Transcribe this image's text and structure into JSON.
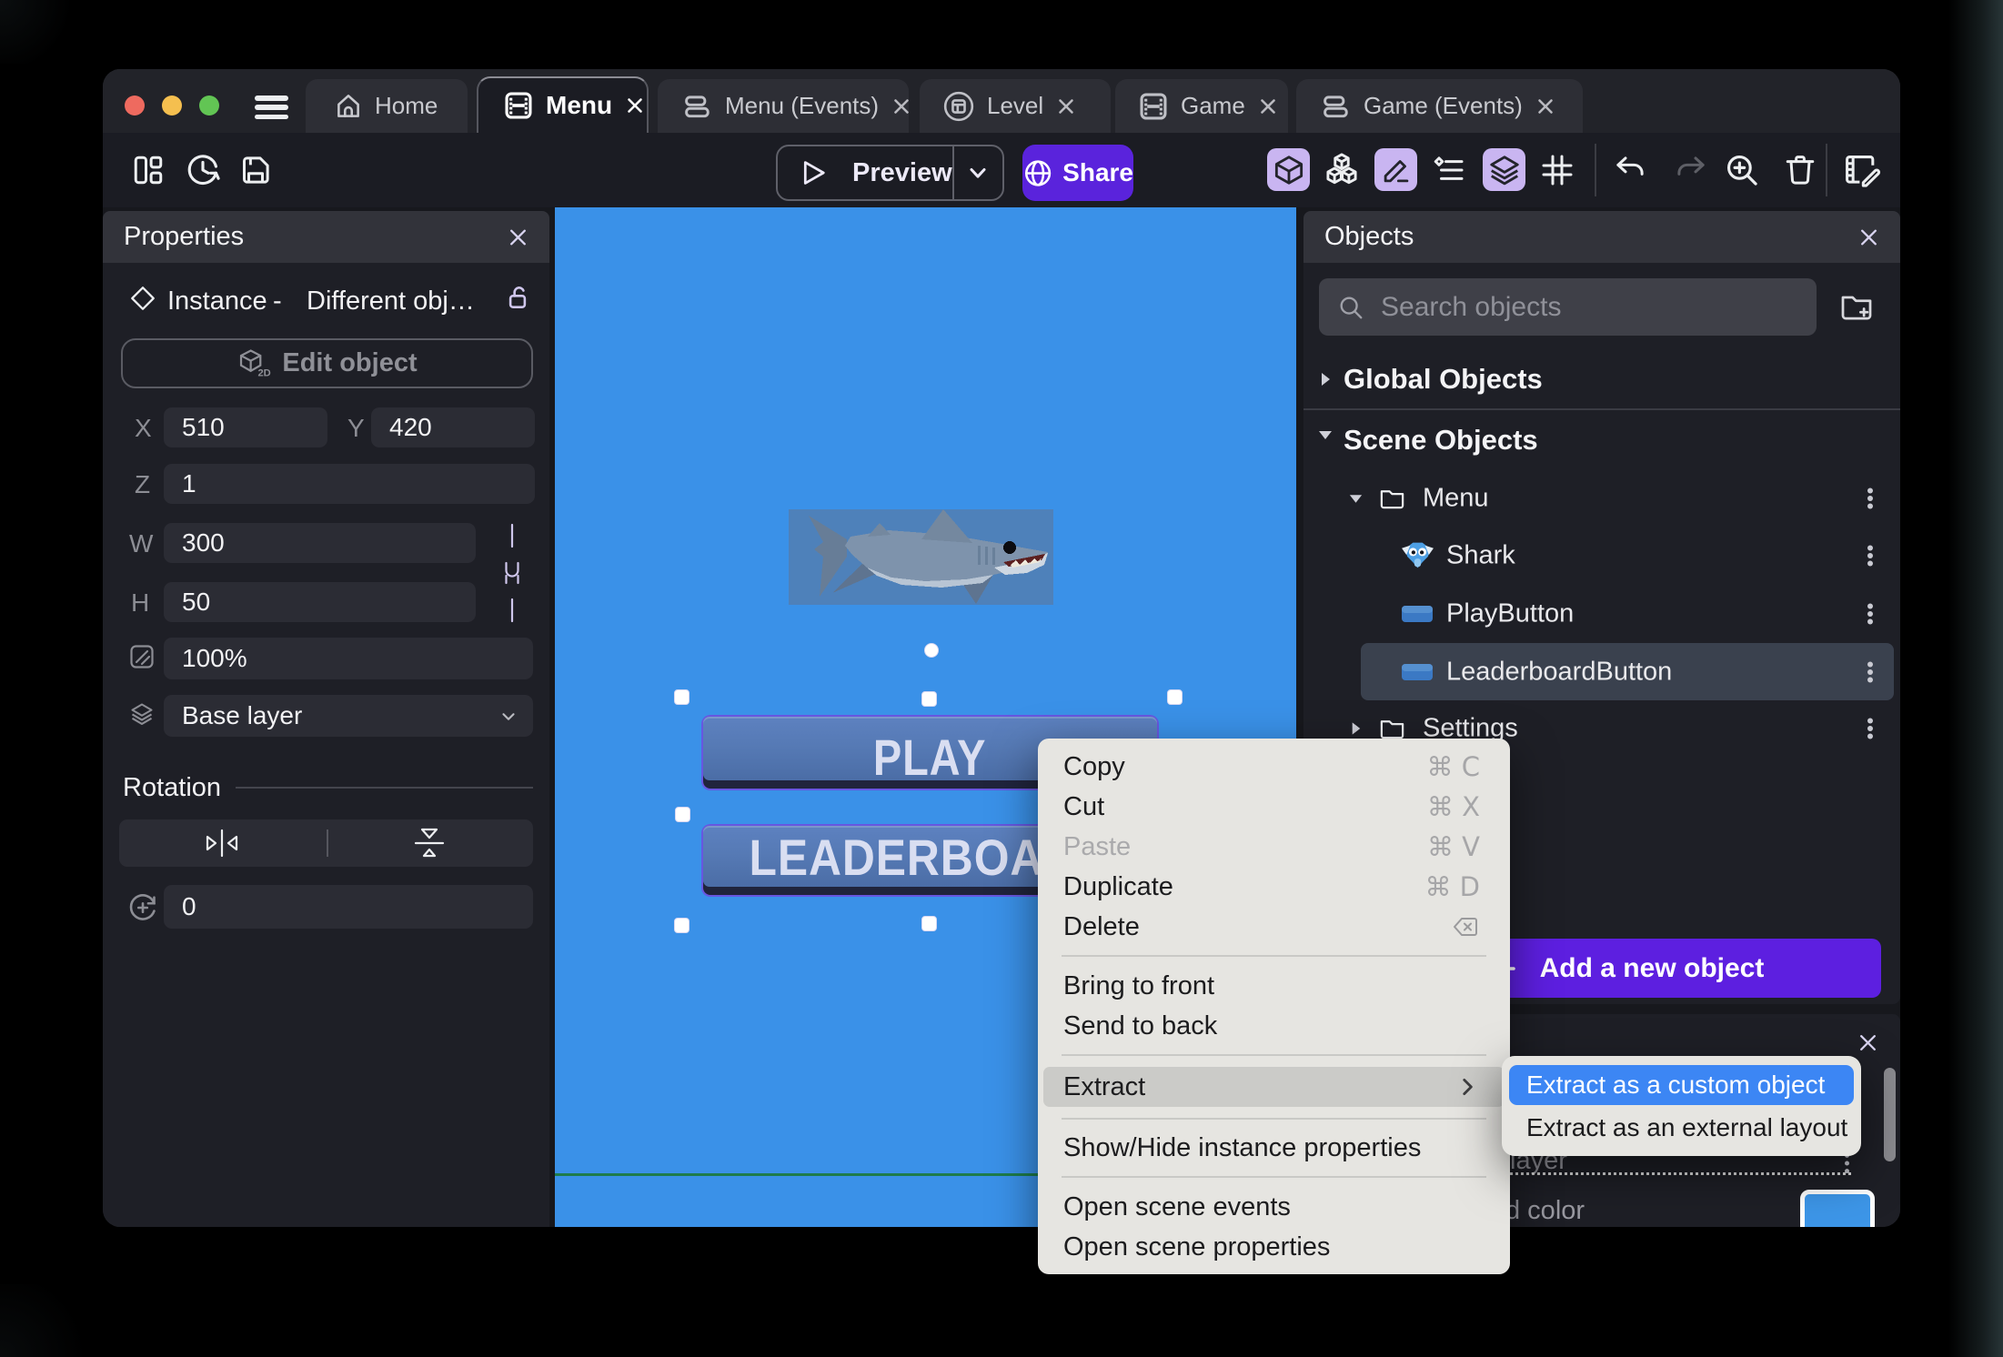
{
  "window": {
    "traffic_lights": {
      "close": "#ee6a5f",
      "minimize": "#f5bf4f",
      "zoom": "#62c554"
    }
  },
  "tabs": [
    {
      "label": "Home",
      "icon": "home-icon",
      "closable": false,
      "active": false
    },
    {
      "label": "Menu",
      "icon": "scene-icon",
      "closable": true,
      "active": true
    },
    {
      "label": "Menu (Events)",
      "icon": "events-icon",
      "closable": true,
      "active": false
    },
    {
      "label": "Level",
      "icon": "external-layout-icon",
      "closable": true,
      "active": false
    },
    {
      "label": "Game",
      "icon": "scene-icon",
      "closable": true,
      "active": false
    },
    {
      "label": "Game (Events)",
      "icon": "events-icon",
      "closable": true,
      "active": false
    }
  ],
  "toolbar": {
    "preview_label": "Preview",
    "share_label": "Share",
    "accent_purple": "#5a23dc",
    "icon_highlight": "#c9b5f1",
    "icons_left": [
      "panels-icon",
      "history-icon",
      "save-icon"
    ],
    "icons_right": [
      "cube-3d-icon",
      "instances-icon",
      "pencil-icon",
      "instance-list-icon",
      "layers-icon",
      "grid-icon",
      "undo-icon",
      "redo-icon",
      "zoom-in-icon",
      "trash-icon",
      "scene-edit-icon"
    ]
  },
  "properties_panel": {
    "title": "Properties",
    "instance_type": "Instance",
    "instance_sep": "-",
    "instance_name": "Different obj…",
    "edit_object_label": "Edit object",
    "labels": {
      "x": "X",
      "y": "Y",
      "z": "Z",
      "w": "W",
      "h": "H"
    },
    "values": {
      "x": "510",
      "y": "420",
      "z": "1",
      "w": "300",
      "h": "50",
      "opacity": "100%",
      "layer": "Base layer",
      "rotation": "0"
    },
    "rotation_title": "Rotation"
  },
  "canvas": {
    "background": "#3a91e8",
    "play_label": "PLAY",
    "leaderboard_label": "LEADERBOARD",
    "scene_border_color": "#1e7c4c"
  },
  "objects_panel": {
    "title": "Objects",
    "search_placeholder": "Search objects",
    "global_section": "Global Objects",
    "scene_section": "Scene Objects",
    "tree": [
      {
        "label": "Menu",
        "type": "folder",
        "expanded": true
      },
      {
        "label": "Shark",
        "type": "sprite"
      },
      {
        "label": "PlayButton",
        "type": "button"
      },
      {
        "label": "LeaderboardButton",
        "type": "button",
        "selected": true
      },
      {
        "label": "Settings",
        "type": "folder",
        "expanded": false
      }
    ],
    "add_button_label": "Add a new object"
  },
  "bottom_panel": {
    "layer_text": "layer",
    "color_text": "d color",
    "swatch_color": "#3d96e8"
  },
  "context_menu": {
    "items": [
      {
        "label": "Copy",
        "shortcut": "⌘ C"
      },
      {
        "label": "Cut",
        "shortcut": "⌘ X"
      },
      {
        "label": "Paste",
        "shortcut": "⌘ V",
        "disabled": true
      },
      {
        "label": "Duplicate",
        "shortcut": "⌘ D"
      },
      {
        "label": "Delete",
        "icon": "backspace-icon"
      },
      {
        "label": "Bring to front"
      },
      {
        "label": "Send to back"
      },
      {
        "label": "Extract",
        "submenu": true
      },
      {
        "label": "Show/Hide instance properties"
      },
      {
        "label": "Open scene events"
      },
      {
        "label": "Open scene properties"
      }
    ]
  },
  "sub_menu": {
    "items": [
      {
        "label": "Extract as a custom object",
        "selected": true
      },
      {
        "label": "Extract as an external layout"
      }
    ]
  }
}
